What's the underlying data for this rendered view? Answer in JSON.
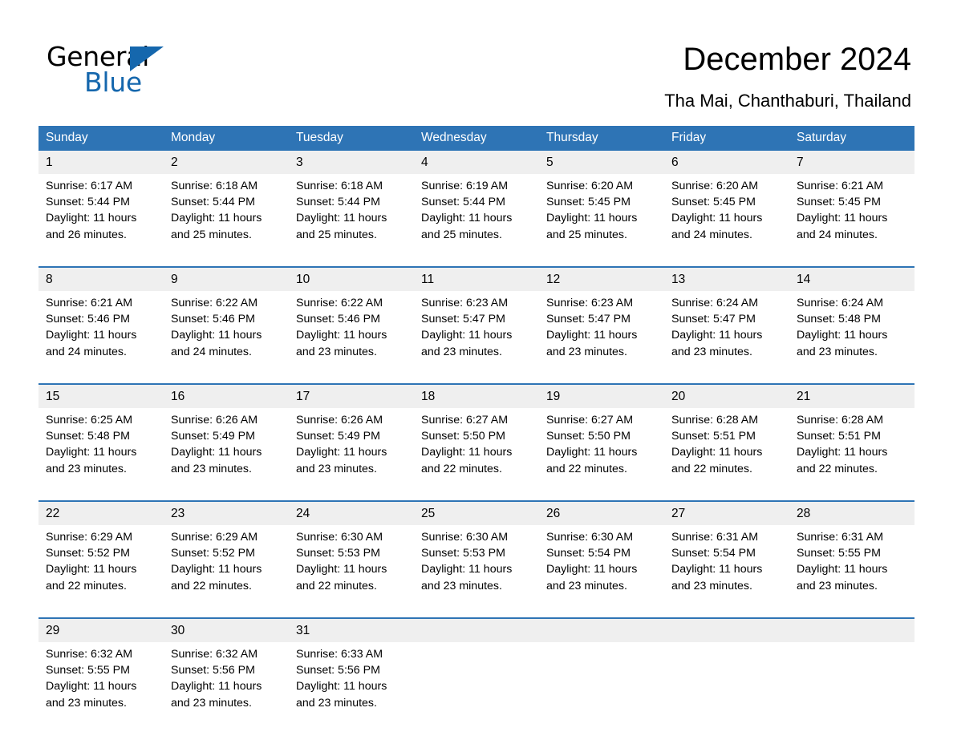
{
  "brand": {
    "name_part1": "General",
    "name_part2": "Blue",
    "triangle_color": "#1567ad",
    "accent_color": "#2e74b5"
  },
  "header": {
    "title": "December 2024",
    "location": "Tha Mai, Chanthaburi, Thailand"
  },
  "weekday_headers": [
    "Sunday",
    "Monday",
    "Tuesday",
    "Wednesday",
    "Thursday",
    "Friday",
    "Saturday"
  ],
  "labels": {
    "sunrise_prefix": "Sunrise:",
    "sunset_prefix": "Sunset:",
    "daylight_prefix": "Daylight:"
  },
  "weeks": [
    {
      "days": [
        {
          "date": "1",
          "sunrise": "Sunrise: 6:17 AM",
          "sunset": "Sunset: 5:44 PM",
          "daylight_line1": "Daylight: 11 hours",
          "daylight_line2": "and 26 minutes."
        },
        {
          "date": "2",
          "sunrise": "Sunrise: 6:18 AM",
          "sunset": "Sunset: 5:44 PM",
          "daylight_line1": "Daylight: 11 hours",
          "daylight_line2": "and 25 minutes."
        },
        {
          "date": "3",
          "sunrise": "Sunrise: 6:18 AM",
          "sunset": "Sunset: 5:44 PM",
          "daylight_line1": "Daylight: 11 hours",
          "daylight_line2": "and 25 minutes."
        },
        {
          "date": "4",
          "sunrise": "Sunrise: 6:19 AM",
          "sunset": "Sunset: 5:44 PM",
          "daylight_line1": "Daylight: 11 hours",
          "daylight_line2": "and 25 minutes."
        },
        {
          "date": "5",
          "sunrise": "Sunrise: 6:20 AM",
          "sunset": "Sunset: 5:45 PM",
          "daylight_line1": "Daylight: 11 hours",
          "daylight_line2": "and 25 minutes."
        },
        {
          "date": "6",
          "sunrise": "Sunrise: 6:20 AM",
          "sunset": "Sunset: 5:45 PM",
          "daylight_line1": "Daylight: 11 hours",
          "daylight_line2": "and 24 minutes."
        },
        {
          "date": "7",
          "sunrise": "Sunrise: 6:21 AM",
          "sunset": "Sunset: 5:45 PM",
          "daylight_line1": "Daylight: 11 hours",
          "daylight_line2": "and 24 minutes."
        }
      ]
    },
    {
      "days": [
        {
          "date": "8",
          "sunrise": "Sunrise: 6:21 AM",
          "sunset": "Sunset: 5:46 PM",
          "daylight_line1": "Daylight: 11 hours",
          "daylight_line2": "and 24 minutes."
        },
        {
          "date": "9",
          "sunrise": "Sunrise: 6:22 AM",
          "sunset": "Sunset: 5:46 PM",
          "daylight_line1": "Daylight: 11 hours",
          "daylight_line2": "and 24 minutes."
        },
        {
          "date": "10",
          "sunrise": "Sunrise: 6:22 AM",
          "sunset": "Sunset: 5:46 PM",
          "daylight_line1": "Daylight: 11 hours",
          "daylight_line2": "and 23 minutes."
        },
        {
          "date": "11",
          "sunrise": "Sunrise: 6:23 AM",
          "sunset": "Sunset: 5:47 PM",
          "daylight_line1": "Daylight: 11 hours",
          "daylight_line2": "and 23 minutes."
        },
        {
          "date": "12",
          "sunrise": "Sunrise: 6:23 AM",
          "sunset": "Sunset: 5:47 PM",
          "daylight_line1": "Daylight: 11 hours",
          "daylight_line2": "and 23 minutes."
        },
        {
          "date": "13",
          "sunrise": "Sunrise: 6:24 AM",
          "sunset": "Sunset: 5:47 PM",
          "daylight_line1": "Daylight: 11 hours",
          "daylight_line2": "and 23 minutes."
        },
        {
          "date": "14",
          "sunrise": "Sunrise: 6:24 AM",
          "sunset": "Sunset: 5:48 PM",
          "daylight_line1": "Daylight: 11 hours",
          "daylight_line2": "and 23 minutes."
        }
      ]
    },
    {
      "days": [
        {
          "date": "15",
          "sunrise": "Sunrise: 6:25 AM",
          "sunset": "Sunset: 5:48 PM",
          "daylight_line1": "Daylight: 11 hours",
          "daylight_line2": "and 23 minutes."
        },
        {
          "date": "16",
          "sunrise": "Sunrise: 6:26 AM",
          "sunset": "Sunset: 5:49 PM",
          "daylight_line1": "Daylight: 11 hours",
          "daylight_line2": "and 23 minutes."
        },
        {
          "date": "17",
          "sunrise": "Sunrise: 6:26 AM",
          "sunset": "Sunset: 5:49 PM",
          "daylight_line1": "Daylight: 11 hours",
          "daylight_line2": "and 23 minutes."
        },
        {
          "date": "18",
          "sunrise": "Sunrise: 6:27 AM",
          "sunset": "Sunset: 5:50 PM",
          "daylight_line1": "Daylight: 11 hours",
          "daylight_line2": "and 22 minutes."
        },
        {
          "date": "19",
          "sunrise": "Sunrise: 6:27 AM",
          "sunset": "Sunset: 5:50 PM",
          "daylight_line1": "Daylight: 11 hours",
          "daylight_line2": "and 22 minutes."
        },
        {
          "date": "20",
          "sunrise": "Sunrise: 6:28 AM",
          "sunset": "Sunset: 5:51 PM",
          "daylight_line1": "Daylight: 11 hours",
          "daylight_line2": "and 22 minutes."
        },
        {
          "date": "21",
          "sunrise": "Sunrise: 6:28 AM",
          "sunset": "Sunset: 5:51 PM",
          "daylight_line1": "Daylight: 11 hours",
          "daylight_line2": "and 22 minutes."
        }
      ]
    },
    {
      "days": [
        {
          "date": "22",
          "sunrise": "Sunrise: 6:29 AM",
          "sunset": "Sunset: 5:52 PM",
          "daylight_line1": "Daylight: 11 hours",
          "daylight_line2": "and 22 minutes."
        },
        {
          "date": "23",
          "sunrise": "Sunrise: 6:29 AM",
          "sunset": "Sunset: 5:52 PM",
          "daylight_line1": "Daylight: 11 hours",
          "daylight_line2": "and 22 minutes."
        },
        {
          "date": "24",
          "sunrise": "Sunrise: 6:30 AM",
          "sunset": "Sunset: 5:53 PM",
          "daylight_line1": "Daylight: 11 hours",
          "daylight_line2": "and 22 minutes."
        },
        {
          "date": "25",
          "sunrise": "Sunrise: 6:30 AM",
          "sunset": "Sunset: 5:53 PM",
          "daylight_line1": "Daylight: 11 hours",
          "daylight_line2": "and 23 minutes."
        },
        {
          "date": "26",
          "sunrise": "Sunrise: 6:30 AM",
          "sunset": "Sunset: 5:54 PM",
          "daylight_line1": "Daylight: 11 hours",
          "daylight_line2": "and 23 minutes."
        },
        {
          "date": "27",
          "sunrise": "Sunrise: 6:31 AM",
          "sunset": "Sunset: 5:54 PM",
          "daylight_line1": "Daylight: 11 hours",
          "daylight_line2": "and 23 minutes."
        },
        {
          "date": "28",
          "sunrise": "Sunrise: 6:31 AM",
          "sunset": "Sunset: 5:55 PM",
          "daylight_line1": "Daylight: 11 hours",
          "daylight_line2": "and 23 minutes."
        }
      ]
    },
    {
      "days": [
        {
          "date": "29",
          "sunrise": "Sunrise: 6:32 AM",
          "sunset": "Sunset: 5:55 PM",
          "daylight_line1": "Daylight: 11 hours",
          "daylight_line2": "and 23 minutes."
        },
        {
          "date": "30",
          "sunrise": "Sunrise: 6:32 AM",
          "sunset": "Sunset: 5:56 PM",
          "daylight_line1": "Daylight: 11 hours",
          "daylight_line2": "and 23 minutes."
        },
        {
          "date": "31",
          "sunrise": "Sunrise: 6:33 AM",
          "sunset": "Sunset: 5:56 PM",
          "daylight_line1": "Daylight: 11 hours",
          "daylight_line2": "and 23 minutes."
        },
        {
          "date": "",
          "sunrise": "",
          "sunset": "",
          "daylight_line1": "",
          "daylight_line2": ""
        },
        {
          "date": "",
          "sunrise": "",
          "sunset": "",
          "daylight_line1": "",
          "daylight_line2": ""
        },
        {
          "date": "",
          "sunrise": "",
          "sunset": "",
          "daylight_line1": "",
          "daylight_line2": ""
        },
        {
          "date": "",
          "sunrise": "",
          "sunset": "",
          "daylight_line1": "",
          "daylight_line2": ""
        }
      ]
    }
  ]
}
